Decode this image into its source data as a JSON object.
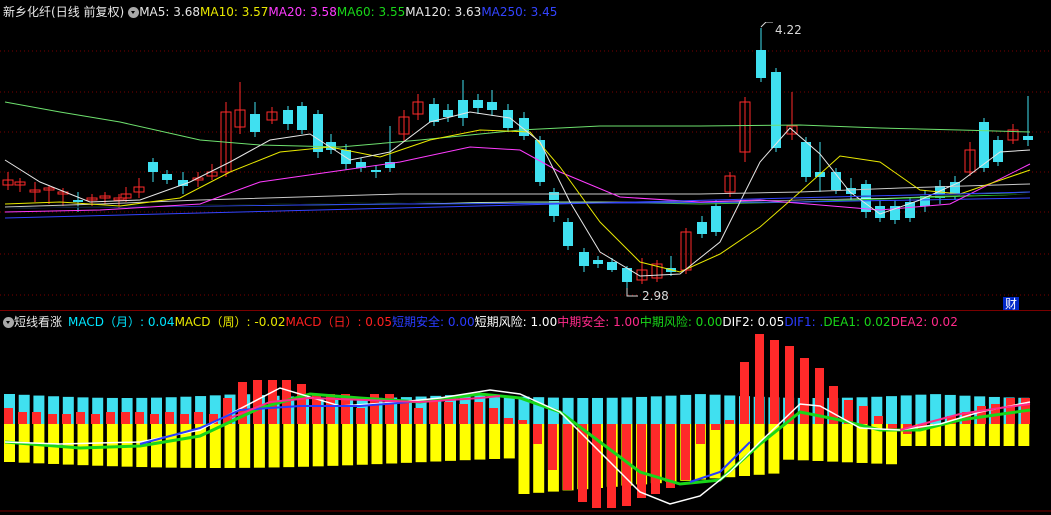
{
  "price_panel": {
    "stock_name": "新乡化纤",
    "mode": "(日线 前复权)",
    "indicators": [
      {
        "label": "MA5:",
        "value": "3.68",
        "color": "#e6e6e6"
      },
      {
        "label": "MA10:",
        "value": "3.57",
        "color": "#e8e800"
      },
      {
        "label": "MA20:",
        "value": "3.58",
        "color": "#ff3cff"
      },
      {
        "label": "MA60:",
        "value": "3.55",
        "color": "#19d619"
      },
      {
        "label": "MA120:",
        "value": "3.63",
        "color": "#e6e6e6"
      },
      {
        "label": "MA250:",
        "value": "3.45",
        "color": "#3344ff"
      }
    ],
    "high_label": "4.22",
    "low_label": "2.98",
    "badge": "财"
  },
  "indicator_panel": {
    "name": "短线看涨",
    "items": [
      {
        "label": "MACD（月）:",
        "value": "0.04",
        "color": "#00e5ff"
      },
      {
        "label": "MACD（周）:",
        "value": "-0.02",
        "color": "#e8e800"
      },
      {
        "label": "MACD（日）:",
        "value": "0.05",
        "color": "#ff2020"
      },
      {
        "label": "短期安全:",
        "value": "0.00",
        "color": "#2a3cff"
      },
      {
        "label": "短期风险:",
        "value": "1.00",
        "color": "#ffffff"
      },
      {
        "label": "中期安全:",
        "value": "1.00",
        "color": "#ff2a8a"
      },
      {
        "label": "中期风险:",
        "value": "0.00",
        "color": "#19d619"
      },
      {
        "label": "DIF2:",
        "value": "0.05",
        "color": "#ffffff"
      },
      {
        "label": "DIF1:",
        "value": ".",
        "color": "#2a3cff"
      },
      {
        "label": "DEA1:",
        "value": "0.02",
        "color": "#19d619"
      },
      {
        "label": "DEA2:",
        "value": "0.02",
        "color": "#ff2a8a"
      }
    ]
  },
  "colors": {
    "up": "#ff2a2a",
    "down": "#40e0f0",
    "background": "#000000",
    "grid": "#7a0000"
  }
}
